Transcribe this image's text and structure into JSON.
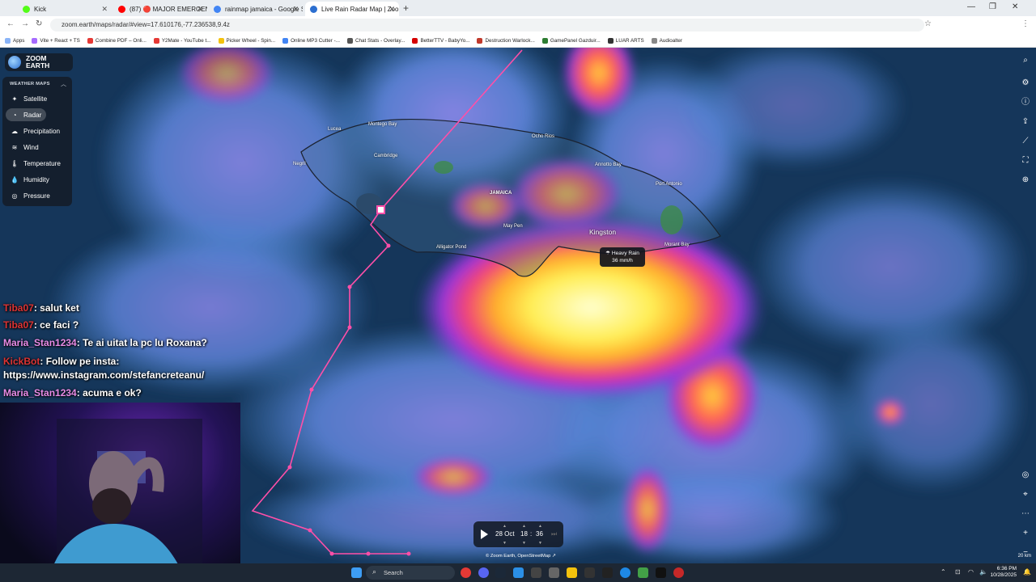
{
  "browser": {
    "tabs": [
      {
        "label": "Kick",
        "color": "#53fc18"
      },
      {
        "label": "(87) 🔴 MAJOR EMERGEN",
        "color": "#ff0000"
      },
      {
        "label": "rainmap jamaica - Google Sear",
        "color": "#4285f4"
      },
      {
        "label": "Live Rain Radar Map | Zoom Ea",
        "color": "#2c6fd0"
      }
    ],
    "url": "zoom.earth/maps/radar/#view=17.610176,-77.236538,9.4z",
    "bookmarks": [
      {
        "label": "Apps",
        "color": "#8ab4f8"
      },
      {
        "label": "Vite + React + TS",
        "color": "#a66bff"
      },
      {
        "label": "Combine PDF – Onli...",
        "color": "#e53935"
      },
      {
        "label": "Y2Mate - YouTube t...",
        "color": "#e53935"
      },
      {
        "label": "Picker Wheel - Spin...",
        "color": "#f4c20d"
      },
      {
        "label": "Online MP3 Cutter -...",
        "color": "#4285f4"
      },
      {
        "label": "Chat Stats - Overlay...",
        "color": "#555555"
      },
      {
        "label": "BetterTTV - BabyYo...",
        "color": "#d50000"
      },
      {
        "label": "Destruction Warlock...",
        "color": "#c0392b"
      },
      {
        "label": "GamePanel Gazduir...",
        "color": "#2e7d32"
      },
      {
        "label": "LUAR ARTS",
        "color": "#333333"
      },
      {
        "label": "Audioalter",
        "color": "#888888"
      }
    ]
  },
  "zoom_earth": {
    "logo_line1": "ZOOM",
    "logo_line2": "EARTH",
    "panel_title": "WEATHER MAPS",
    "layers": [
      {
        "label": "Satellite",
        "icon": "satellite-icon",
        "glyph": "✦"
      },
      {
        "label": "Radar",
        "icon": "radar-icon",
        "glyph": "◔"
      },
      {
        "label": "Precipitation",
        "icon": "rain-cloud-icon",
        "glyph": "☁"
      },
      {
        "label": "Wind",
        "icon": "wind-icon",
        "glyph": "≋"
      },
      {
        "label": "Temperature",
        "icon": "thermometer-icon",
        "glyph": "🌡"
      },
      {
        "label": "Humidity",
        "icon": "droplet-icon",
        "glyph": "💧"
      },
      {
        "label": "Pressure",
        "icon": "gauge-icon",
        "glyph": "◎"
      }
    ],
    "selected_layer": "Radar",
    "places": [
      {
        "name": "Lucea",
        "big": false
      },
      {
        "name": "Montego Bay",
        "big": false
      },
      {
        "name": "Ocho Rios",
        "big": false
      },
      {
        "name": "Cambridge",
        "big": false
      },
      {
        "name": "Negril",
        "big": false
      },
      {
        "name": "Annotto Bay",
        "big": false
      },
      {
        "name": "JAMAICA",
        "big": false
      },
      {
        "name": "Port Antonio",
        "big": false
      },
      {
        "name": "May Pen",
        "big": false
      },
      {
        "name": "Kingston",
        "big": true
      },
      {
        "name": "Alligator Pond",
        "big": false
      },
      {
        "name": "Morant Bay",
        "big": false
      }
    ],
    "tooltip_title": "Heavy Rain",
    "tooltip_value": "36 mm/h",
    "playback_date": "28 Oct",
    "playback_hour": "18",
    "playback_sep": ":",
    "playback_minute": "36",
    "attribution": "© Zoom Earth, OpenStreetMap ↗",
    "scale": "20 km"
  },
  "chat": [
    {
      "user": "Tiba07",
      "msg": "salut ket",
      "cls": "u"
    },
    {
      "user": "Tiba07",
      "msg": "ce faci ?",
      "cls": "u"
    },
    {
      "user": "Maria_Stan1234",
      "msg": "Te ai uitat la pc lu Roxana?",
      "cls": "ux"
    },
    {
      "user": "KickBot",
      "msg": "Follow pe insta:",
      "cls": "u"
    },
    {
      "user": "",
      "msg": "https://www.instagram.com/stefancreteanu/",
      "cls": ""
    },
    {
      "user": "Maria_Stan1234",
      "msg": "acuma e ok?",
      "cls": "ux"
    }
  ],
  "taskbar": {
    "search_placeholder": "Search",
    "time": "6:36 PM",
    "date": "10/28/2025"
  }
}
